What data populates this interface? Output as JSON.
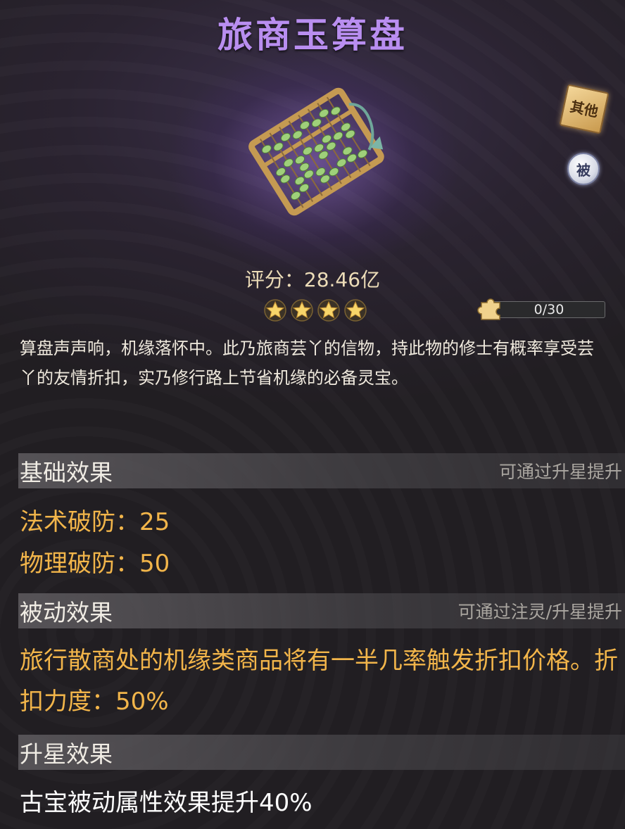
{
  "item": {
    "name": "旅商玉算盘",
    "score": "评分：28.46亿",
    "stars": 4,
    "fragment_progress": "0/30",
    "fragment_fraction": 0,
    "tag_other": "其他",
    "tag_passive": "被",
    "description": "算盘声声响，机缘落怀中。此乃旅商芸丫的信物，持此物的修士有概率享受芸丫的友情折扣，实乃修行路上节省机缘的必备灵宝。"
  },
  "sections": {
    "basic": {
      "title": "基础效果",
      "hint": "可通过升星提升",
      "stats": [
        "法术破防：25",
        "物理破防：50"
      ]
    },
    "passive": {
      "title": "被动效果",
      "hint": "可通过注灵/升星提升",
      "text": "旅行散商处的机缘类商品将有一半几率触发折扣价格。折扣力度：50%"
    },
    "upgrade": {
      "title": "升星效果",
      "text": "古宝被动属性效果提升40%"
    }
  },
  "colors": {
    "title": "#b98ef0",
    "stat": "#f2b54a",
    "star": "#f7d56a"
  },
  "icons": [
    "abacus-icon",
    "star-icon",
    "puzzle-fragment-icon"
  ]
}
